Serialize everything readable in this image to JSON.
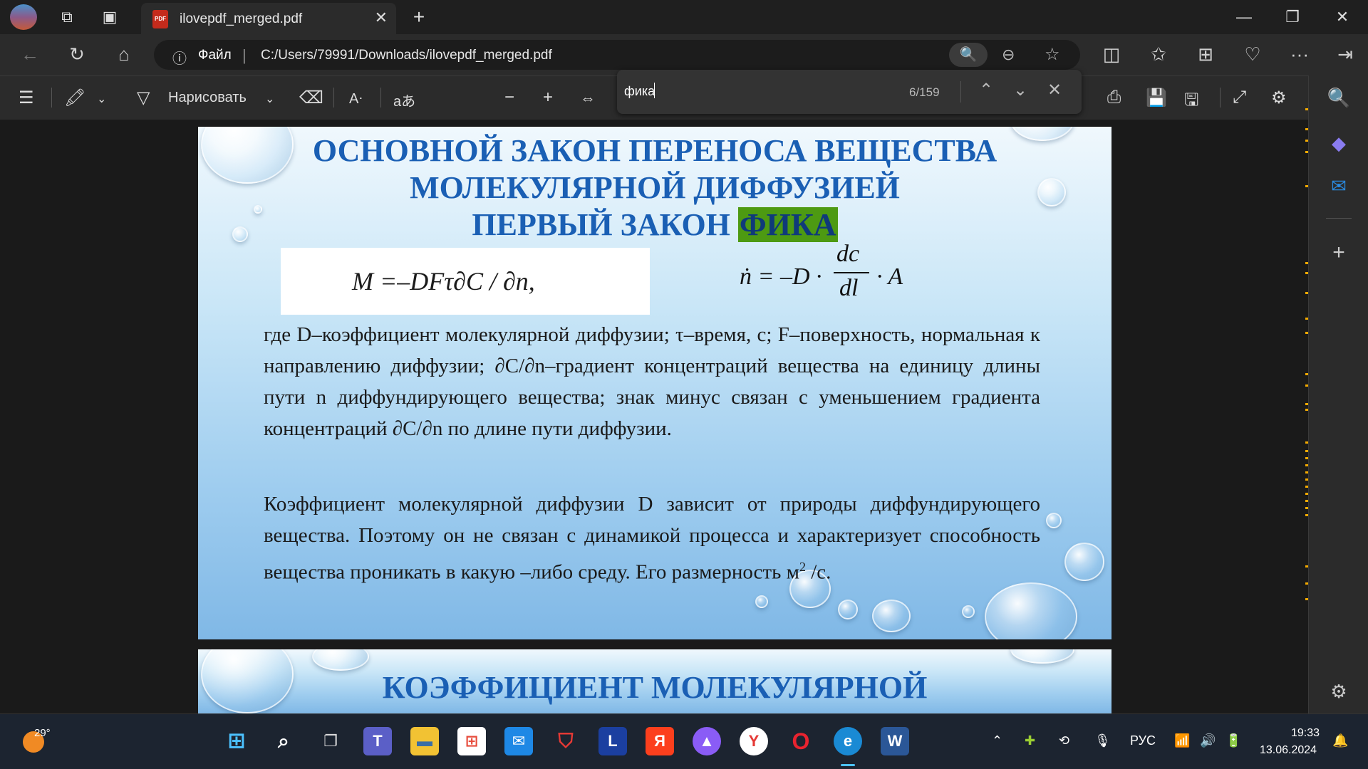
{
  "browser": {
    "tab_title": "ilovepdf_merged.pdf",
    "pdf_badge": "PDF",
    "address_label": "Файл",
    "url": "C:/Users/79991/Downloads/ilovepdf_merged.pdf"
  },
  "pdf_toolbar": {
    "draw_label": "Нарисовать"
  },
  "find": {
    "query": "фика",
    "count": "6/159"
  },
  "page1": {
    "title_line1": "ОСНОВНОЙ ЗАКОН ПЕРЕНОСА ВЕЩЕСТВА",
    "title_line2": "МОЛЕКУЛЯРНОЙ ДИФФУЗИЕЙ",
    "title_line3_prefix": "ПЕРВЫЙ ЗАКОН",
    "title_line3_highlight": "ФИКА",
    "formula1": "M  =–DFτ∂C / ∂n,",
    "formula2_lhs": "ṅ = –D ·",
    "formula2_num": "dc",
    "formula2_den": "dl",
    "formula2_rhs": "· A",
    "paragraph1": "где D–коэффициент молекулярной диффузии; τ–время, с; F–поверхность, нормальная к направлению диффузии; ∂C/∂n–градиент концентраций вещества на единицу длины пути n диффундирующего вещества; знак минус связан с уменьшением градиента концентраций ∂C/∂n по длине пути диффузии.",
    "paragraph2": "Коэффициент молекулярной диффузии D зависит от природы диффундирующего вещества. Поэтому он не связан с динамикой процесса и характеризует способность вещества проникать в какую –либо среду. Его размерность м",
    "paragraph2_sup": "2",
    "paragraph2_end": " /с."
  },
  "page2": {
    "title_line1": "КОЭФФИЦИЕНТ МОЛЕКУЛЯРНОЙ"
  },
  "taskbar": {
    "weather_temp": "29°",
    "language": "РУС",
    "time": "19:33",
    "date": "13.06.2024"
  }
}
